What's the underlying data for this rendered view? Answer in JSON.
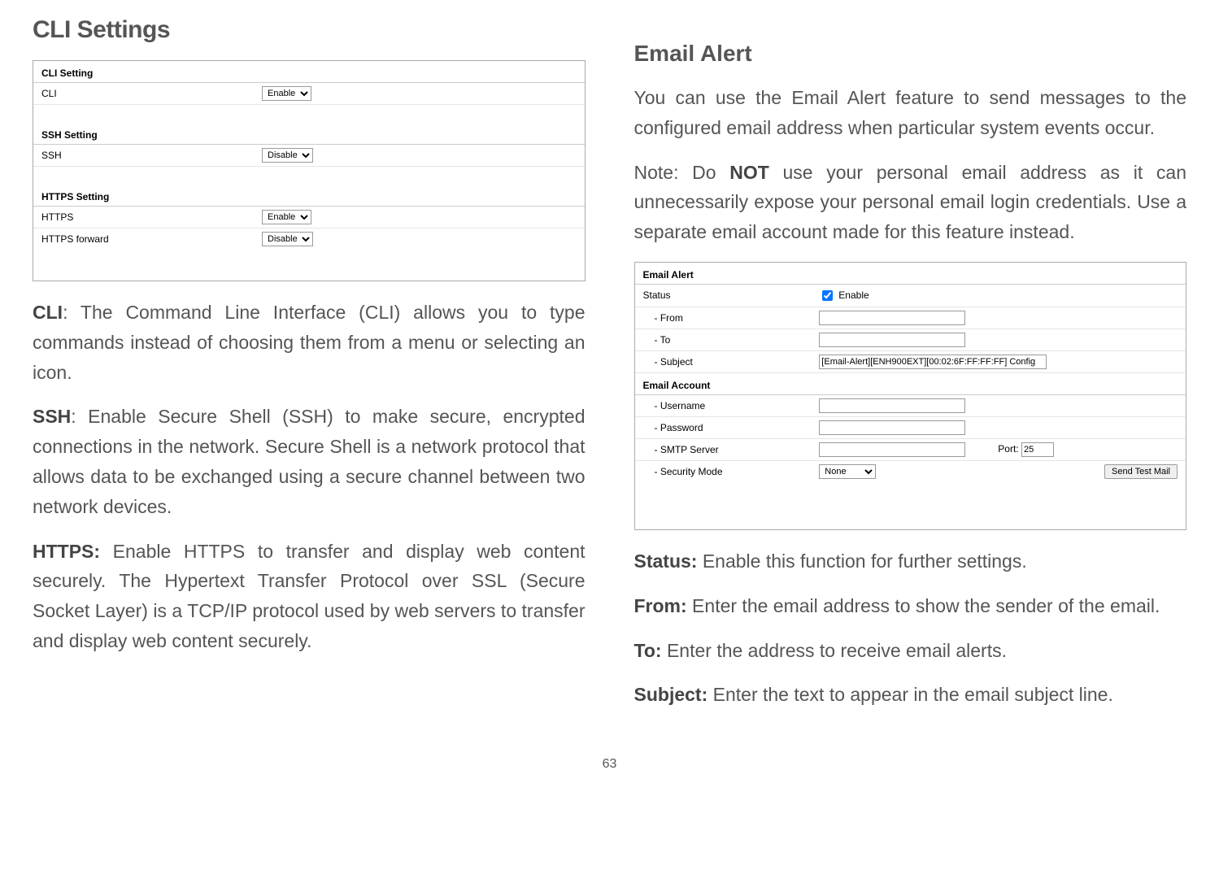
{
  "page_number": "63",
  "left": {
    "title": "CLI Settings",
    "cli_screenshot": {
      "sec1": "CLI Setting",
      "row1_label": "CLI",
      "row1_value": "Enable",
      "sec2": "SSH Setting",
      "row2_label": "SSH",
      "row2_value": "Disable",
      "sec3": "HTTPS Setting",
      "row3_label": "HTTPS",
      "row3_value": "Enable",
      "row4_label": "HTTPS forward",
      "row4_value": "Disable"
    },
    "p1_bold": "CLI",
    "p1_rest": ": The Command Line Interface (CLI) allows you to type commands instead of choosing them from a menu or selecting an icon.",
    "p2_bold": "SSH",
    "p2_rest": ": Enable Secure Shell (SSH) to make secure, encrypted connections in the network. Secure Shell is a network protocol that allows data to be exchanged using a secure channel between two network devices.",
    "p3_bold": "HTTPS:",
    "p3_rest": " Enable HTTPS to transfer and display web content securely. The Hypertext Transfer Protocol over SSL (Secure Socket Layer) is a TCP/IP protocol used by web servers to transfer and display web content securely."
  },
  "right": {
    "title": "Email Alert",
    "intro": "You can use the Email Alert feature to send messages to the configured email address when particular system events occur.",
    "note_prefix": "  Note: Do ",
    "note_bold": "NOT",
    "note_rest": " use your personal email address as it can unnecessarily expose your personal email login credentials. Use a separate email account made for this feature instead.",
    "email_screenshot": {
      "sec1": "Email Alert",
      "status_label": "Status",
      "status_cb_label": "Enable",
      "from_label": "- From",
      "to_label": "- To",
      "subject_label": "- Subject",
      "subject_value": "[Email-Alert][ENH900EXT][00:02:6F:FF:FF:FF] Config",
      "sec2": "Email Account",
      "username_label": "- Username",
      "password_label": "- Password",
      "smtp_label": "- SMTP Server",
      "port_label": "Port:",
      "port_value": "25",
      "security_label": "- Security Mode",
      "security_value": "None",
      "send_btn": "Send Test Mail"
    },
    "p_status_bold": "Status:",
    "p_status_rest": " Enable this function for further settings.",
    "p_from_bold": "From:",
    "p_from_rest": " Enter the email address to show the sender of the email.",
    "p_to_bold": "To:",
    "p_to_rest": " Enter the address to receive email alerts.",
    "p_subject_bold": "Subject:",
    "p_subject_rest": " Enter the text to appear in the email subject line."
  }
}
